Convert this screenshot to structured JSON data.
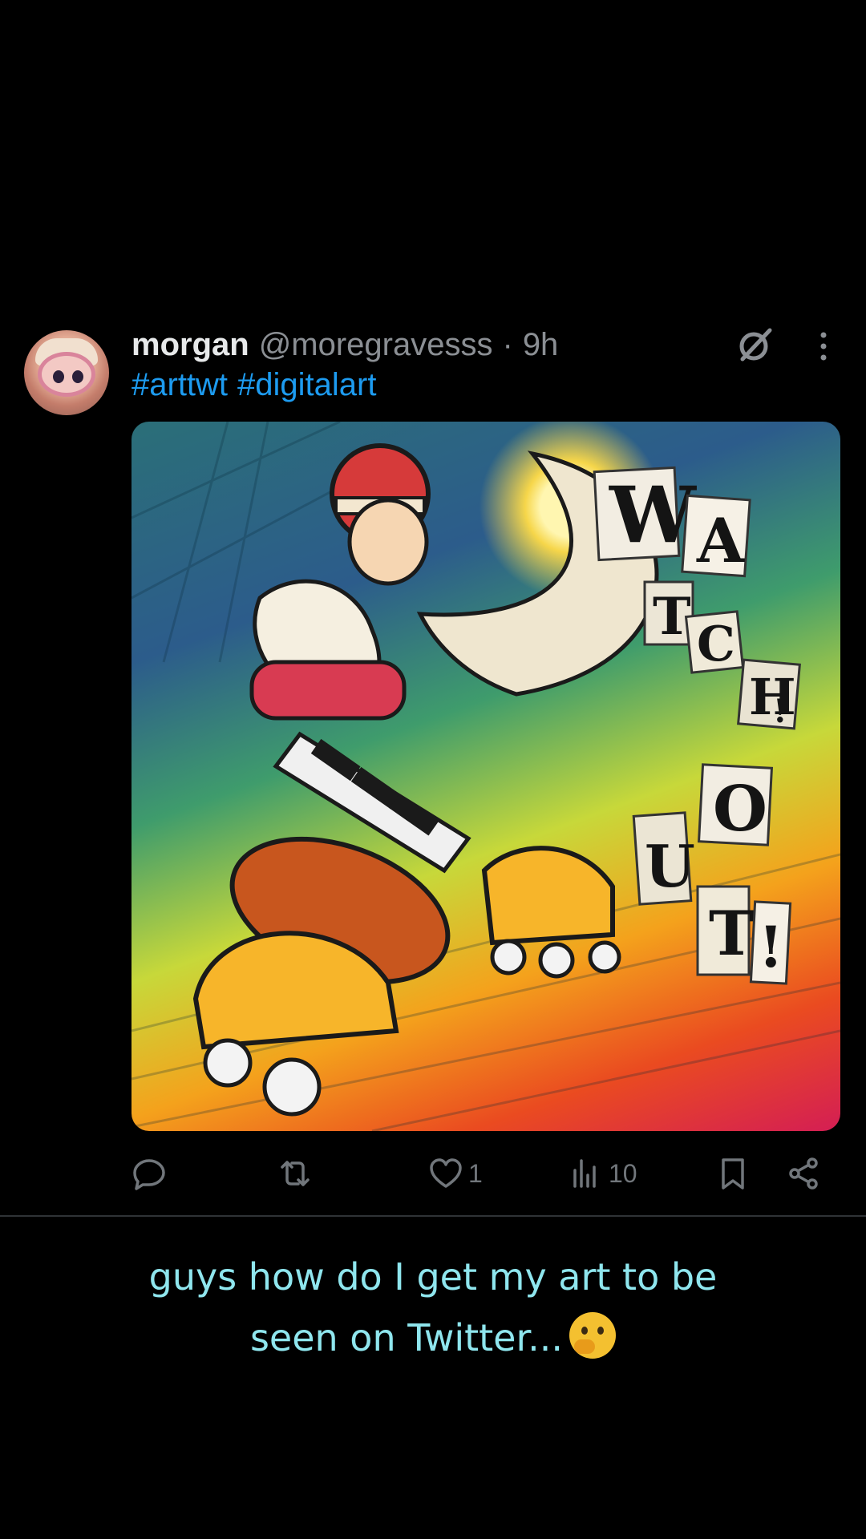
{
  "tweet": {
    "author_name": "morgan",
    "author_handle": "@moregravesss",
    "separator": "·",
    "time": "9h",
    "hashtags": [
      "#arttwt",
      "#digitalart"
    ],
    "media_text_letters": [
      "W",
      "A",
      "T",
      "C",
      "H",
      "!",
      "O",
      "U",
      "T",
      "!"
    ],
    "actions": {
      "reply_count": "",
      "retweet_count": "",
      "like_count": "1",
      "view_count": "10"
    }
  },
  "caption": {
    "line1": "guys how do I get my art to be",
    "line2": "seen on Twitter...",
    "emoji": "thinking-face-emoji"
  },
  "colors": {
    "background": "#000000",
    "hashtag": "#1d9bf0",
    "caption": "#8fe6ee",
    "icon": "#71767b"
  }
}
